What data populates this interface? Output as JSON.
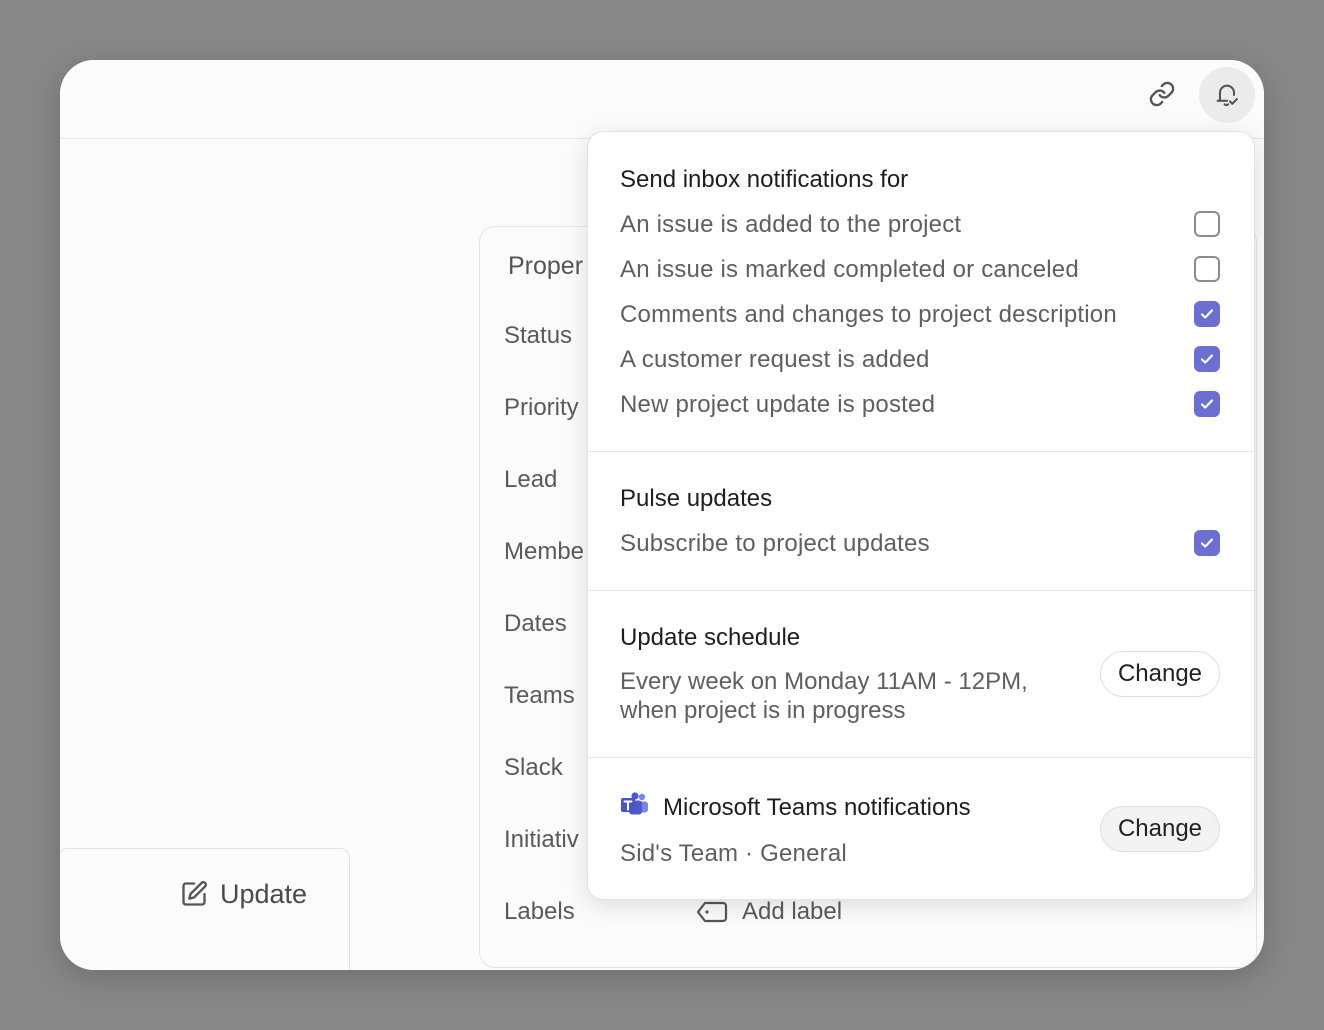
{
  "toolbar": {
    "link_icon": "link-icon",
    "bell_icon": "bell-check-icon"
  },
  "update_card": {
    "label": "Update",
    "icon": "compose-icon"
  },
  "properties": {
    "title": "Proper",
    "labels": [
      "Status",
      "Priority",
      "Lead",
      "Membe",
      "Dates",
      "Teams",
      "Slack",
      "Initiativ",
      "Labels"
    ],
    "add_label": "Add label"
  },
  "notifications": {
    "inbox": {
      "title": "Send inbox notifications for",
      "items": [
        {
          "label": "An issue is added to the project",
          "checked": false
        },
        {
          "label": "An issue is marked completed or canceled",
          "checked": false
        },
        {
          "label": "Comments and changes to project description",
          "checked": true
        },
        {
          "label": "A customer request is added",
          "checked": true
        },
        {
          "label": "New project update is posted",
          "checked": true
        }
      ]
    },
    "pulse": {
      "title": "Pulse updates",
      "item": {
        "label": "Subscribe to project updates",
        "checked": true
      }
    },
    "schedule": {
      "title": "Update schedule",
      "line1": "Every week on Monday 11AM - 12PM,",
      "line2": "when project is in progress",
      "button": "Change"
    },
    "teams": {
      "title": "Microsoft Teams notifications",
      "subtitle": "Sid's Team · General",
      "button": "Change",
      "icon": "microsoft-teams-icon"
    }
  },
  "colors": {
    "accent": "#6c6fd1",
    "backdrop": "#878787"
  }
}
